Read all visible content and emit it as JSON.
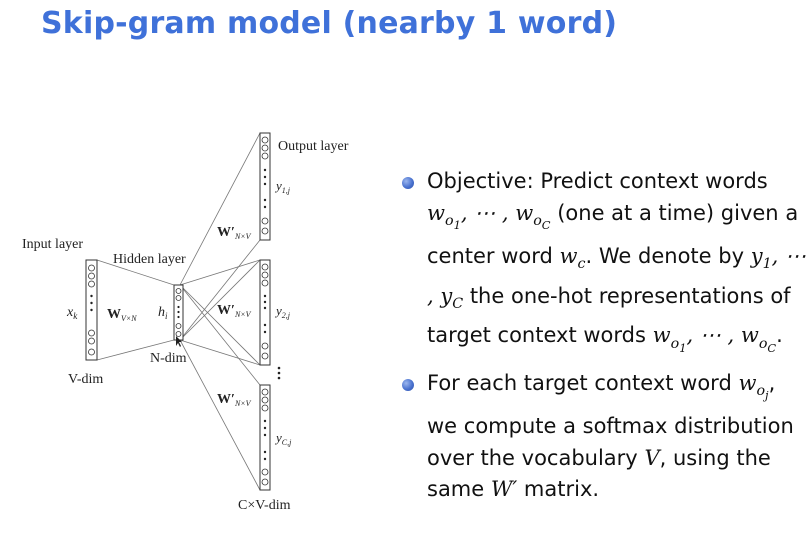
{
  "title": "Skip-gram model (nearby 1 word)",
  "diagram": {
    "input_layer": "Input layer",
    "hidden_layer": "Hidden layer",
    "output_layer": "Output layer",
    "v_dim": "V-dim",
    "n_dim": "N-dim",
    "cv_dim": "C×V-dim",
    "x_k": "x",
    "x_k_sub": "k",
    "h_i": "h",
    "h_i_sub": "i",
    "w_in": "W",
    "w_in_sub": "V×N",
    "w_out": "W′",
    "w_out_sub": "N×V",
    "y1": "y",
    "y1_sub": "1,j",
    "y2": "y",
    "y2_sub": "2,j",
    "yc": "y",
    "yc_sub": "C,j"
  },
  "bullets": {
    "b1": {
      "t1": "Objective: Predict context words",
      "t2": "(one at a time) given",
      "t3": "a center word",
      "t4": ". We denote by",
      "t5": "the one-hot",
      "t6": "representations of target context",
      "t7": "words"
    },
    "b2": {
      "t1": "For each target context word",
      "t2": "we compute a softmax distribution",
      "t3": "over the vocabulary",
      "t4": ", using the",
      "t5": "same",
      "t6": "matrix."
    }
  },
  "colors": {
    "title": "#3f71d9",
    "bullet": "#4a72cf"
  }
}
